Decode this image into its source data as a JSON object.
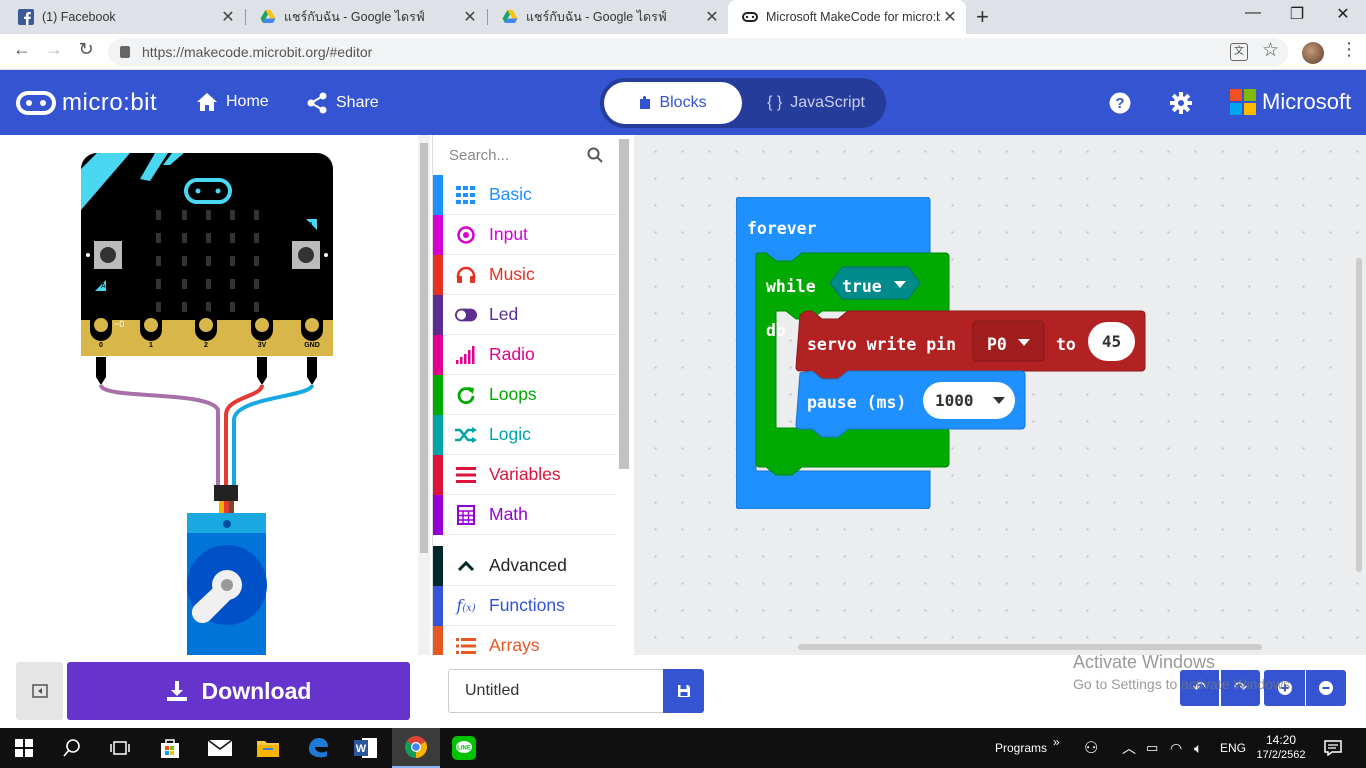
{
  "browser": {
    "tabs": [
      {
        "title": "(1) Facebook",
        "icon": "facebook-icon"
      },
      {
        "title": "แชร์กับฉัน - Google ไดรฟ์",
        "icon": "google-drive-icon"
      },
      {
        "title": "แชร์กับฉัน - Google ไดรฟ์",
        "icon": "google-drive-icon"
      },
      {
        "title": "Microsoft MakeCode for micro:bi",
        "icon": "makecode-icon"
      }
    ],
    "new_tab": "+",
    "url": "https://makecode.microbit.org/#editor",
    "window_controls": {
      "minimize": "—",
      "maximize": "❐",
      "close": "✕"
    }
  },
  "header": {
    "logo": "micro:bit",
    "home": "Home",
    "share": "Share",
    "blocks": "Blocks",
    "javascript": "JavaScript",
    "javascript_prefix": "{ }",
    "brand": "Microsoft",
    "accent": "#3454d1"
  },
  "simulator": {
    "pin_labels": [
      "0",
      "1",
      "2",
      "3V",
      "GND"
    ],
    "button_a": "A",
    "button_b": "B",
    "pin0_marker": "~0"
  },
  "toolbox": {
    "search_placeholder": "Search...",
    "categories": [
      {
        "label": "Basic",
        "color": "#1e90ff",
        "icon": "grid-icon"
      },
      {
        "label": "Input",
        "color": "#d400d4",
        "icon": "target-icon"
      },
      {
        "label": "Music",
        "color": "#e63022",
        "icon": "headphones-icon"
      },
      {
        "label": "Led",
        "color": "#5c2d91",
        "icon": "toggle-icon"
      },
      {
        "label": "Radio",
        "color": "#e3008c",
        "icon": "signal-bars-icon"
      },
      {
        "label": "Loops",
        "color": "#00aa00",
        "icon": "refresh-icon"
      },
      {
        "label": "Logic",
        "color": "#00a4a6",
        "icon": "shuffle-icon"
      },
      {
        "label": "Variables",
        "color": "#dc143c",
        "icon": "list-icon"
      },
      {
        "label": "Math",
        "color": "#9400d3",
        "icon": "calculator-icon"
      }
    ],
    "advanced": [
      {
        "label": "Advanced",
        "color": "#00272b",
        "icon": "chevron-up-icon"
      },
      {
        "label": "Functions",
        "color": "#3455db",
        "icon": "function-icon"
      },
      {
        "label": "Arrays",
        "color": "#e65722",
        "icon": "array-list-icon"
      }
    ]
  },
  "workspace": {
    "forever": "forever",
    "while": "while",
    "true_value": "true",
    "do": "do",
    "servo_label": "servo write pin",
    "pin": "P0",
    "to": "to",
    "servo_value": "45",
    "pause_label": "pause (ms)",
    "pause_value": "1000",
    "colors": {
      "basic": "#1e90ff",
      "loops": "#00aa00",
      "servo": "#b22222",
      "logic": "#008b8b"
    }
  },
  "editor_toolbar": {
    "download": "Download",
    "project_name": "Untitled"
  },
  "watermark": {
    "line1": "Activate Windows",
    "line2": "Go to Settings to activate Windows."
  },
  "taskbar": {
    "programs": "Programs",
    "chevron": "»",
    "language": "ENG",
    "time": "14:20",
    "date": "17/2/2562"
  }
}
